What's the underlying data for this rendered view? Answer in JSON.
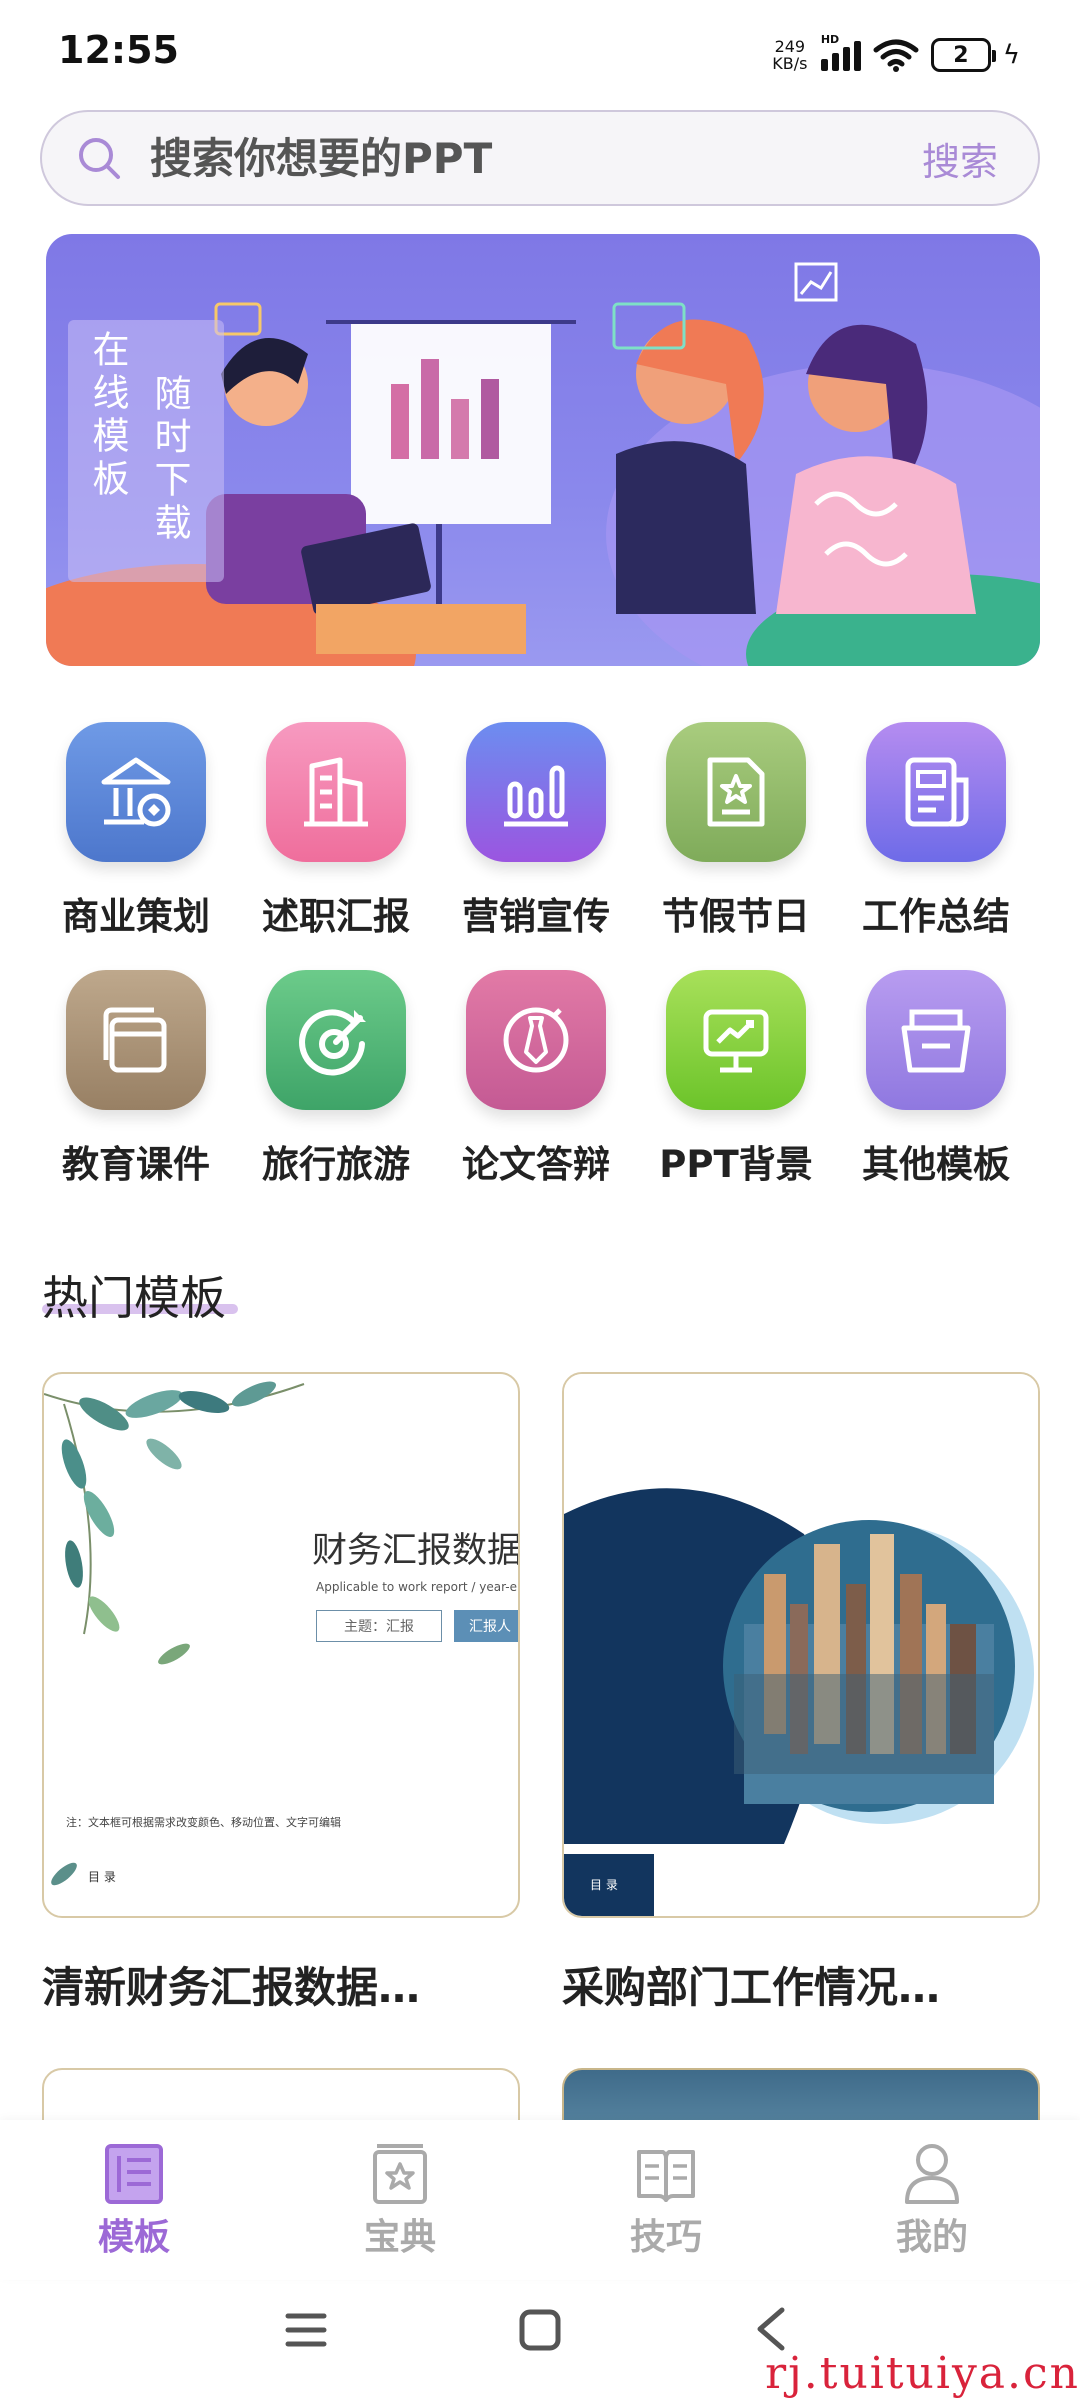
{
  "status_bar": {
    "time": "12:55",
    "net_speed_value": "249",
    "net_speed_unit": "KB/s",
    "hd_label": "HD",
    "battery": "2"
  },
  "search": {
    "placeholder": "搜索你想要的PPT",
    "button_label": "搜索"
  },
  "banner": {
    "tag_line_1": "在线模板",
    "tag_line_2": "随时下载"
  },
  "categories": [
    {
      "label": "商业策划",
      "icon": "institution-icon",
      "color": "#5a86d8"
    },
    {
      "label": "述职汇报",
      "icon": "building-icon",
      "color": "#f27fa8"
    },
    {
      "label": "营销宣传",
      "icon": "bar-chart-icon",
      "color": "#8b63e6"
    },
    {
      "label": "节假节日",
      "icon": "star-document-icon",
      "color": "#93bb6a"
    },
    {
      "label": "工作总结",
      "icon": "newspaper-icon",
      "color": "#8c72ea"
    },
    {
      "label": "教育课件",
      "icon": "layers-icon",
      "color": "#a89072"
    },
    {
      "label": "旅行旅游",
      "icon": "target-icon",
      "color": "#4db074"
    },
    {
      "label": "论文答辩",
      "icon": "tie-icon",
      "color": "#d46fa0"
    },
    {
      "label": "PPT背景",
      "icon": "presentation-icon",
      "color": "#86d23c"
    },
    {
      "label": "其他模板",
      "icon": "folder-icon",
      "color": "#9c83e4"
    }
  ],
  "section": {
    "title": "热门模板"
  },
  "templates": [
    {
      "title": "清新财务汇报数据…",
      "thumb_title": "财务汇报数据",
      "thumb_subtitle": "Applicable to work report / year-end summ",
      "thumb_theme": "主题：汇报",
      "thumb_reporter": "汇报人",
      "thumb_note": "注：文本框可根据需求改变颜色、移动位置、文字可编辑",
      "thumb_toc": "目 录"
    },
    {
      "title": "采购部门工作情况…",
      "thumb_toc": "目 录"
    }
  ],
  "bottom_nav": [
    {
      "label": "模板",
      "icon": "template-list-icon",
      "active": true
    },
    {
      "label": "宝典",
      "icon": "book-star-icon",
      "active": false
    },
    {
      "label": "技巧",
      "icon": "open-book-icon",
      "active": false
    },
    {
      "label": "我的",
      "icon": "user-icon",
      "active": false
    }
  ],
  "watermark": "rj.tuituiya.cn",
  "colors": {
    "accent": "#9c69d6",
    "search_button": "#a98ad6",
    "banner_bg": "#8a88ec"
  }
}
